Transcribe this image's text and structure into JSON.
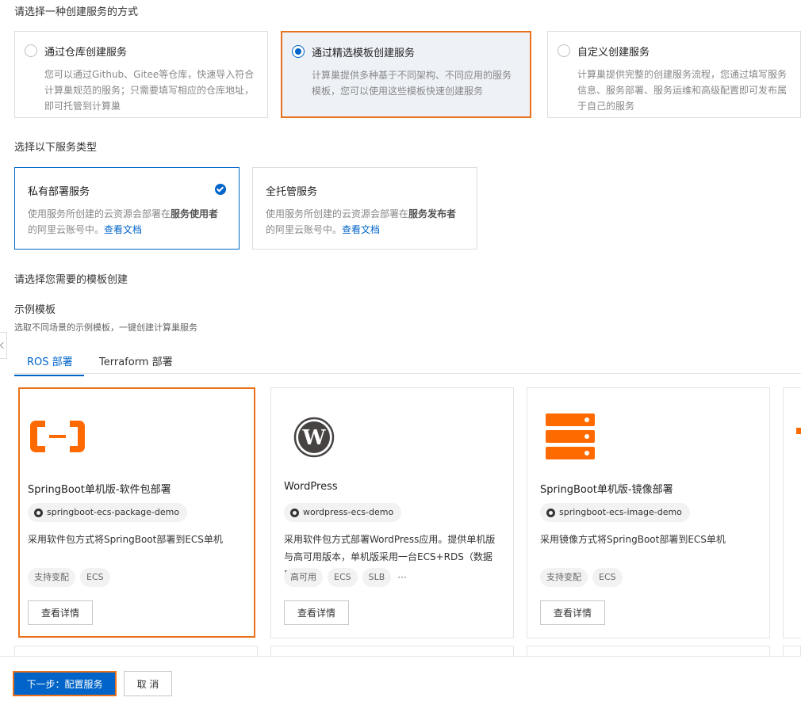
{
  "method_section": {
    "title": "请选择一种创建服务的方式",
    "options": [
      {
        "title": "通过仓库创建服务",
        "desc": "您可以通过Github、Gitee等仓库，快速导入符合计算巢规范的服务；只需要填写相应的仓库地址，即可托管到计算巢"
      },
      {
        "title": "通过精选模板创建服务",
        "desc": "计算巢提供多种基于不同架构、不同应用的服务模板，您可以使用这些模板快速创建服务"
      },
      {
        "title": "自定义创建服务",
        "desc": "计算巢提供完整的创建服务流程，您通过填写服务信息、服务部署、服务运维和高级配置即可发布属于自己的服务"
      }
    ]
  },
  "type_section": {
    "title": "选择以下服务类型",
    "options": [
      {
        "title": "私有部署服务",
        "desc_pre": "使用服务所创建的云资源会部署在",
        "desc_bold": "服务使用者",
        "desc_post": "的阿里云账号中。",
        "link": "查看文档"
      },
      {
        "title": "全托管服务",
        "desc_pre": "使用服务所创建的云资源会部署在",
        "desc_bold": "服务发布者",
        "desc_post": "的阿里云账号中。",
        "link": "查看文档"
      }
    ]
  },
  "template_section": {
    "title": "请选择您需要的模板创建",
    "subtitle": "示例模板",
    "hint": "选取不同场景的示例模板，一键创建计算巢服务",
    "tabs": [
      "ROS 部署",
      "Terraform 部署"
    ],
    "detail_label": "查看详情",
    "cards": [
      {
        "name": "SpringBoot单机版-软件包部署",
        "repo": "springboot-ecs-package-demo",
        "desc": "采用软件包方式将SpringBoot部署到ECS单机",
        "tags": [
          "支持变配",
          "ECS"
        ],
        "icon": "aliyun-logo-icon"
      },
      {
        "name": "WordPress",
        "repo": "wordpress-ecs-demo",
        "desc": "采用软件包方式部署WordPress应用。提供单机版与高可用版本，单机版采用一台ECS+RDS（数据库...",
        "tags": [
          "高可用",
          "ECS",
          "SLB"
        ],
        "more": "···",
        "icon": "wordpress-logo-icon"
      },
      {
        "name": "SpringBoot单机版-镜像部署",
        "repo": "springboot-ecs-image-demo",
        "desc": "采用镜像方式将SpringBoot部署到ECS单机",
        "tags": [
          "支持变配",
          "ECS"
        ],
        "icon": "server-stack-icon"
      }
    ]
  },
  "footer": {
    "next_label": "下一步：配置服务",
    "cancel_label": "取 消"
  },
  "colors": {
    "accent": "#0064c8",
    "highlight": "#e9711c"
  }
}
